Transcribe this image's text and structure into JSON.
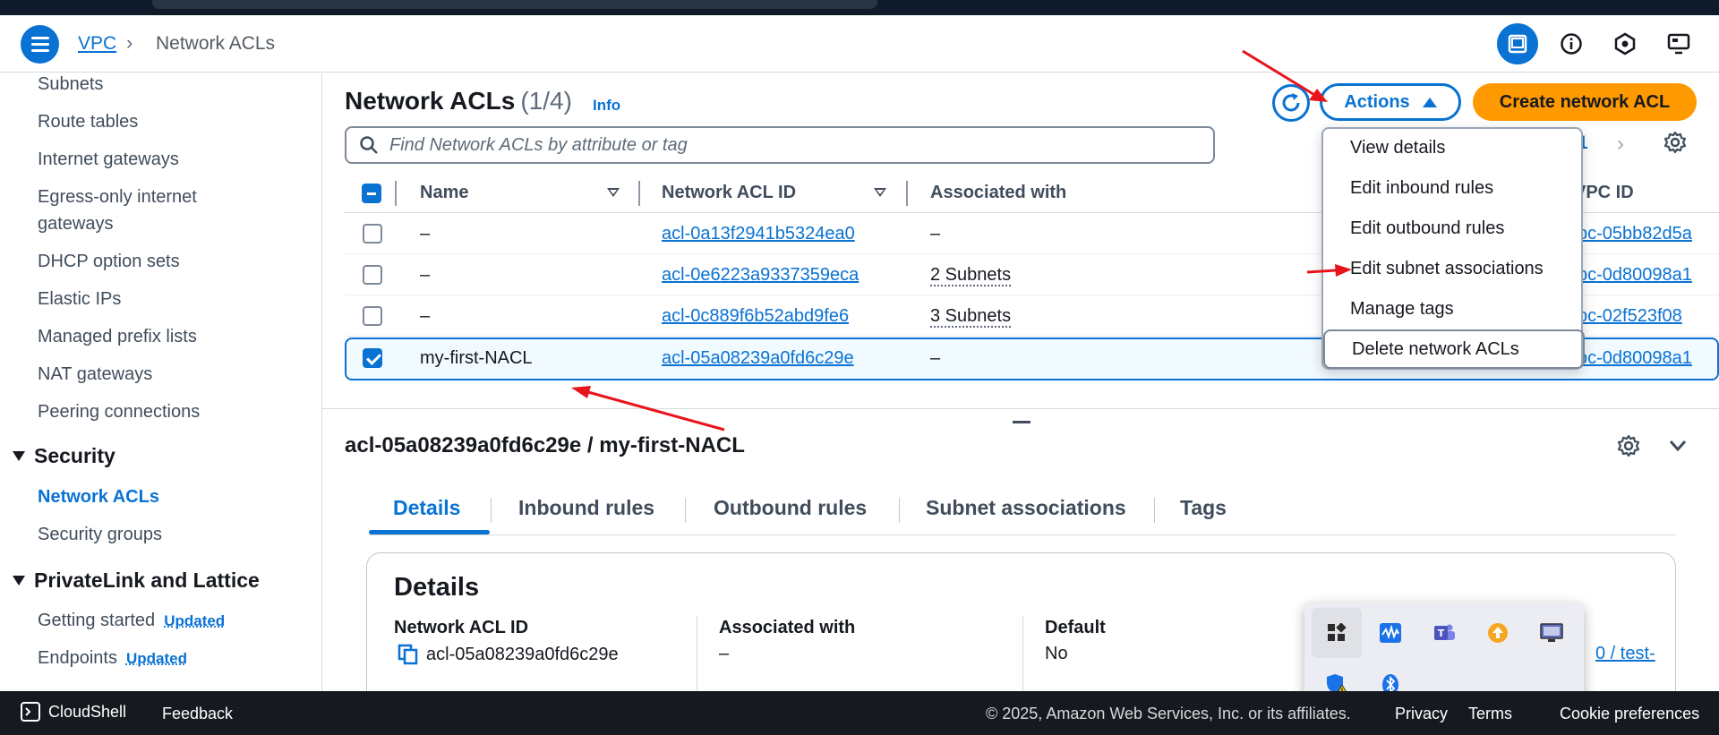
{
  "breadcrumb": {
    "root": "VPC",
    "separator": "›",
    "current": "Network ACLs"
  },
  "sidebar": {
    "items": [
      {
        "label": "Subnets"
      },
      {
        "label": "Route tables"
      },
      {
        "label": "Internet gateways"
      },
      {
        "label": "Egress-only internet"
      },
      {
        "label": "gateways"
      },
      {
        "label": "DHCP option sets"
      },
      {
        "label": "Elastic IPs"
      },
      {
        "label": "Managed prefix lists"
      },
      {
        "label": "NAT gateways"
      },
      {
        "label": "Peering connections"
      }
    ],
    "security": {
      "title": "Security",
      "items": [
        {
          "label": "Network ACLs"
        },
        {
          "label": "Security groups"
        }
      ]
    },
    "privatelink": {
      "title": "PrivateLink and Lattice",
      "items": [
        {
          "label": "Getting started",
          "badge": "Updated"
        },
        {
          "label": "Endpoints",
          "badge": "Updated"
        }
      ]
    }
  },
  "header": {
    "title": "Network ACLs",
    "count": "(1/4)",
    "info": "Info"
  },
  "toolbar": {
    "actions_label": "Actions",
    "create_label": "Create network ACL"
  },
  "search": {
    "placeholder": "Find Network ACLs by attribute or tag"
  },
  "pagination": {
    "page": "1"
  },
  "table": {
    "columns": [
      "Name",
      "Network ACL ID",
      "Associated with",
      "VPC ID"
    ],
    "rows": [
      {
        "name": "–",
        "acl_id": "acl-0a13f2941b5324ea0",
        "associated": "–",
        "vpc": "vpc-05bb82d5a",
        "selected": false
      },
      {
        "name": "–",
        "acl_id": "acl-0e6223a9337359eca",
        "associated": "2 Subnets",
        "vpc": "vpc-0d80098a1",
        "selected": false
      },
      {
        "name": "–",
        "acl_id": "acl-0c889f6b52abd9fe6",
        "associated": "3 Subnets",
        "vpc": "vpc-02f523f08",
        "selected": false
      },
      {
        "name": "my-first-NACL",
        "acl_id": "acl-05a08239a0fd6c29e",
        "associated": "–",
        "vpc": "vpc-0d80098a1",
        "selected": true
      }
    ]
  },
  "actions_menu": {
    "items": [
      "View details",
      "Edit inbound rules",
      "Edit outbound rules",
      "Edit subnet associations",
      "Manage tags",
      "Delete network ACLs"
    ]
  },
  "detail": {
    "title": "acl-05a08239a0fd6c29e / my-first-NACL",
    "tabs": [
      "Details",
      "Inbound rules",
      "Outbound rules",
      "Subnet associations",
      "Tags"
    ],
    "card_title": "Details",
    "fields": [
      {
        "label": "Network ACL ID",
        "value": "acl-05a08239a0fd6c29e"
      },
      {
        "label": "Associated with",
        "value": "–"
      },
      {
        "label": "Default",
        "value": "No"
      }
    ],
    "partial_link": "0 / test-"
  },
  "footer": {
    "cloudshell": "CloudShell",
    "feedback": "Feedback",
    "copyright": "© 2025, Amazon Web Services, Inc. or its affiliates.",
    "privacy": "Privacy",
    "terms": "Terms",
    "cookies": "Cookie preferences"
  },
  "colors": {
    "accent": "#0972d3",
    "primary_button": "#ff9900",
    "footer_bg": "#16191f",
    "annotation": "#e8141c"
  },
  "icons": {
    "top": [
      "panel-icon",
      "info-icon",
      "notifications-icon",
      "display-icon"
    ],
    "tray": [
      "app-grid-icon",
      "waveform-icon",
      "teams-icon",
      "upload-icon",
      "monitor-icon",
      "shield-warning-icon",
      "bluetooth-icon"
    ]
  }
}
